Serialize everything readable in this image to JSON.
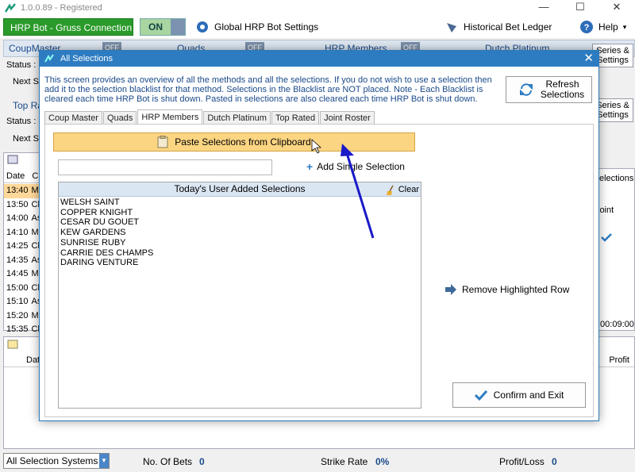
{
  "app": {
    "title": "1.0.0.89 - Registered",
    "window_controls": {
      "minimize": "—",
      "maximize": "☐",
      "close": "✕"
    }
  },
  "toolbar": {
    "connection_label": "HRP Bot - Gruss Connection",
    "toggle_state": "ON",
    "global_settings_label": "Global HRP Bot Settings",
    "ledger_label": "Historical Bet Ledger",
    "help_label": "Help",
    "help_arrow": "▾"
  },
  "background": {
    "tabs": [
      "CoupMaster",
      "Quads",
      "HRP Members",
      "Dutch Platinum"
    ],
    "off_label": "OFF",
    "series_label": "Series &",
    "status_label": "Status :",
    "next_label": "Next S",
    "top_rated_label": "Top Ra",
    "series_settings_label": "Series & Settings",
    "selections_label": "elections",
    "joint_label": "loint",
    "time_label": ":00:09:00",
    "profit_label": "Profit",
    "date_header": "Date",
    "c_header": "C",
    "dat_header": "Dat",
    "rows": [
      {
        "time": "13:40",
        "code": "Mu"
      },
      {
        "time": "13:50",
        "code": "Ch"
      },
      {
        "time": "14:00",
        "code": "As"
      },
      {
        "time": "14:10",
        "code": "Mu"
      },
      {
        "time": "14:25",
        "code": "Ch"
      },
      {
        "time": "14:35",
        "code": "As"
      },
      {
        "time": "14:45",
        "code": "Mu"
      },
      {
        "time": "15:00",
        "code": "Ch"
      },
      {
        "time": "15:10",
        "code": "As"
      },
      {
        "time": "15:20",
        "code": "Mu"
      },
      {
        "time": "15:35",
        "code": "Ch"
      }
    ]
  },
  "bottom": {
    "system_select": "All Selection Systems",
    "bets_label": "No. Of Bets",
    "bets_value": "0",
    "strike_label": "Strike Rate",
    "strike_value": "0%",
    "pl_label": "Profit/Loss",
    "pl_value": "0"
  },
  "dialog": {
    "title": "All Selections",
    "close": "✕",
    "description": "This screen provides an overview of all the methods and all the selections. If you do not wish to use a selection then add it to the selection blacklist for that method. Selections in the Blacklist are NOT placed. Note - Each Blacklist is cleared each time HRP Bot is shut down. Pasted in selections are also cleared each time HRP Bot is shut down.",
    "refresh_label": "Refresh Selections",
    "tabs": [
      {
        "label": "Coup Master",
        "active": false
      },
      {
        "label": "Quads",
        "active": false
      },
      {
        "label": "HRP Members",
        "active": true
      },
      {
        "label": "Dutch Platinum",
        "active": false
      },
      {
        "label": "Top Rated",
        "active": false
      },
      {
        "label": "Joint Roster",
        "active": false
      }
    ],
    "paste_label": "Paste Selections from Clipboard",
    "single_input_value": "",
    "add_single_label": "Add Single Selection",
    "list_header": "Today's User Added Selections",
    "clear_label": "Clear",
    "selections": [
      "WELSH SAINT",
      "COPPER KNIGHT",
      "CESAR DU GOUET",
      "KEW GARDENS",
      "SUNRISE RUBY",
      "CARRIE DES CHAMPS",
      "DARING VENTURE"
    ],
    "remove_label": "Remove Highlighted Row",
    "confirm_label": "Confirm and Exit"
  },
  "colors": {
    "dialog_title": "#2d7cc2",
    "connection_green": "#2a9a2a",
    "paste_button": "#fcd583",
    "highlight_row": "#ffd89a",
    "annotation_arrow": "#1a1ac8"
  },
  "icons": [
    "app-logo-icon",
    "gear-icon",
    "ledger-icon",
    "help-icon",
    "refresh-icon",
    "clipboard-icon",
    "plus-icon",
    "broom-icon",
    "arrow-right-icon",
    "checkmark-icon",
    "calendar-icon"
  ]
}
